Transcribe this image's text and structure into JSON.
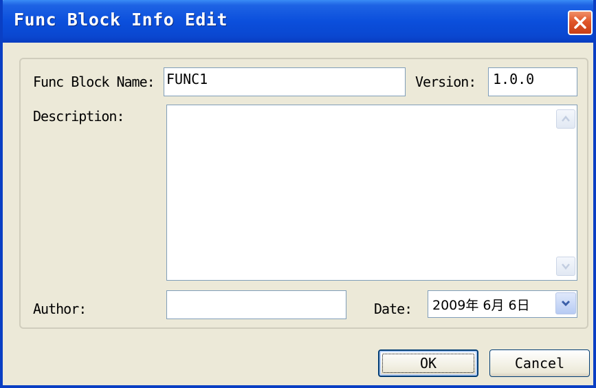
{
  "window": {
    "title": "Func Block Info Edit"
  },
  "form": {
    "name_label": "Func Block Name:",
    "name_value": "FUNC1",
    "version_label": "Version:",
    "version_value": "1.0.0",
    "description_label": "Description:",
    "description_value": "",
    "author_label": "Author:",
    "author_value": "",
    "date_label": "Date:",
    "date_value": "2009年 6月 6日"
  },
  "buttons": {
    "ok_label": "OK",
    "cancel_label": "Cancel"
  },
  "icons": {
    "close": "close-icon",
    "scroll_up": "scroll-up-arrow-icon",
    "scroll_down": "scroll-down-arrow-icon",
    "dropdown": "chevron-down-icon"
  },
  "colors": {
    "titlebar": "#0b4fdc",
    "dialog_bg": "#ece9d8",
    "close_button": "#e0562a"
  }
}
